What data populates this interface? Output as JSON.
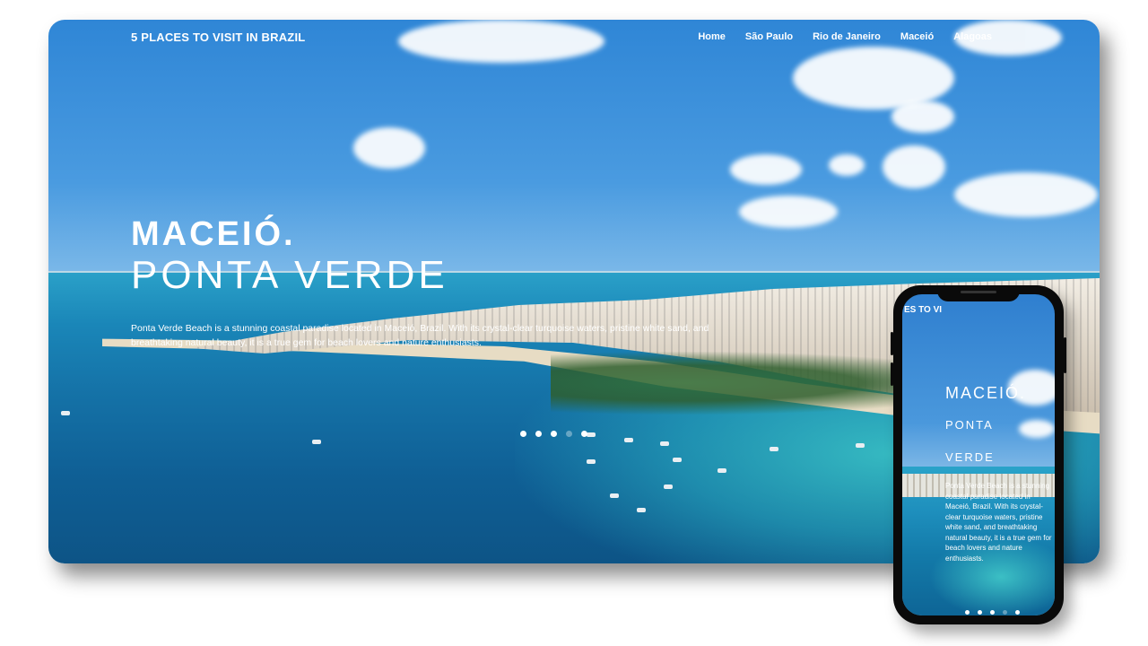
{
  "site": {
    "brand": "5 PLACES TO VISIT IN BRAZIL",
    "nav": [
      "Home",
      "São Paulo",
      "Rio de Janeiro",
      "Maceió",
      "Alagoas"
    ]
  },
  "hero": {
    "kicker": "MACEIÓ.",
    "title": "PONTA VERDE",
    "description": "Ponta Verde Beach is a stunning coastal paradise located in Maceió, Brazil. With its crystal-clear turquoise waters, pristine white sand, and breathtaking natural beauty, it is a true gem for beach lovers and nature enthusiasts.",
    "slides_total": 5,
    "active_slide": 4
  },
  "mobile": {
    "brand_visible": "ES TO VI",
    "kicker": "MACEIÓ.",
    "title_line1": "PONTA",
    "title_line2": "VERDE",
    "description": "Ponta Verde Beach is a stunning coastal paradise located in Maceió, Brazil. With its crystal-clear turquoise waters, pristine white sand, and breathtaking natural beauty, it is a true gem for beach lovers and nature enthusiasts."
  },
  "colors": {
    "sky": "#3a8fda",
    "sea": "#1573a8",
    "text": "#ffffff",
    "phone_frame": "#0a0a0a"
  }
}
